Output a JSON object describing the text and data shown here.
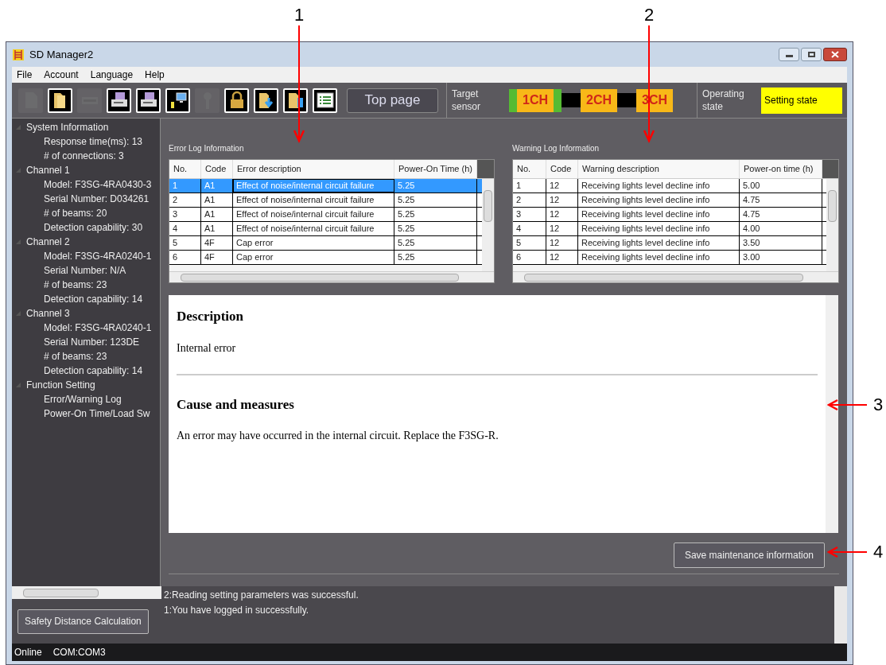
{
  "callouts": [
    {
      "label": "1",
      "kind": "down"
    },
    {
      "label": "2",
      "kind": "down"
    },
    {
      "label": "3",
      "kind": "left"
    },
    {
      "label": "4",
      "kind": "left"
    }
  ],
  "window": {
    "title": "SD Manager2"
  },
  "menu": [
    "File",
    "Account",
    "Language",
    "Help"
  ],
  "toolbar": {
    "buttons": [
      {
        "kind": "document",
        "disabled": true
      },
      {
        "kind": "folder",
        "disabled": false
      },
      {
        "kind": "device",
        "disabled": true
      },
      {
        "kind": "printer",
        "disabled": false
      },
      {
        "kind": "printer",
        "disabled": false
      },
      {
        "kind": "computer",
        "disabled": false
      },
      {
        "kind": "key",
        "disabled": true
      },
      {
        "kind": "lock",
        "disabled": false
      },
      {
        "kind": "folder-download",
        "disabled": false
      },
      {
        "kind": "folder-upload",
        "disabled": false
      },
      {
        "kind": "list",
        "disabled": false
      }
    ],
    "top_page": "Top page"
  },
  "target_sensor": {
    "label": "Target sensor",
    "channels": [
      {
        "label": "1CH",
        "selected": true
      },
      {
        "label": "2CH",
        "selected": false
      },
      {
        "label": "3CH",
        "selected": false
      }
    ]
  },
  "operating_state": {
    "label": "Operating state",
    "value": "Setting state"
  },
  "sidebar": {
    "tree": [
      {
        "label": "System Information",
        "expanded": true,
        "children": [
          {
            "label": "Response time(ms): 13"
          },
          {
            "label": "# of connections: 3"
          }
        ]
      },
      {
        "label": "Channel 1",
        "expanded": true,
        "children": [
          {
            "label": "Model: F3SG-4RA0430-3"
          },
          {
            "label": "Serial Number: D034261"
          },
          {
            "label": "# of beams: 20"
          },
          {
            "label": "Detection capability: 30"
          }
        ]
      },
      {
        "label": "Channel 2",
        "expanded": true,
        "children": [
          {
            "label": "Model: F3SG-4RA0240-1"
          },
          {
            "label": "Serial Number: N/A"
          },
          {
            "label": "# of beams: 23"
          },
          {
            "label": "Detection capability: 14"
          }
        ]
      },
      {
        "label": "Channel 3",
        "expanded": true,
        "children": [
          {
            "label": "Model: F3SG-4RA0240-1"
          },
          {
            "label": "Serial Number: 123DE"
          },
          {
            "label": "# of beams: 23"
          },
          {
            "label": "Detection capability: 14"
          }
        ]
      },
      {
        "label": "Function Setting",
        "expanded": true,
        "children": [
          {
            "label": "Error/Warning Log"
          },
          {
            "label": "Power-On Time/Load Sw"
          }
        ]
      }
    ],
    "button": "Safety Distance Calculation"
  },
  "error_log": {
    "title": "Error Log Information",
    "columns": [
      "No.",
      "Code",
      "Error description",
      "Power-On Time (h)"
    ],
    "rows": [
      {
        "cells": [
          "1",
          "A1",
          "Effect of noise/internal circuit failure",
          "5.25"
        ],
        "selected": true
      },
      {
        "cells": [
          "2",
          "A1",
          "Effect of noise/internal circuit failure",
          "5.25"
        ],
        "selected": false
      },
      {
        "cells": [
          "3",
          "A1",
          "Effect of noise/internal circuit failure",
          "5.25"
        ],
        "selected": false
      },
      {
        "cells": [
          "4",
          "A1",
          "Effect of noise/internal circuit failure",
          "5.25"
        ],
        "selected": false
      },
      {
        "cells": [
          "5",
          "4F",
          "Cap error",
          "5.25"
        ],
        "selected": false
      },
      {
        "cells": [
          "6",
          "4F",
          "Cap error",
          "5.25"
        ],
        "selected": false
      }
    ]
  },
  "warning_log": {
    "title": "Warning Log Information",
    "columns": [
      "No.",
      "Code",
      "Warning description",
      "Power-on time (h)"
    ],
    "rows": [
      {
        "cells": [
          "1",
          "12",
          "Receiving lights level decline info",
          "5.00"
        ],
        "selected": false
      },
      {
        "cells": [
          "2",
          "12",
          "Receiving lights level decline info",
          "4.75"
        ],
        "selected": false
      },
      {
        "cells": [
          "3",
          "12",
          "Receiving lights level decline info",
          "4.75"
        ],
        "selected": false
      },
      {
        "cells": [
          "4",
          "12",
          "Receiving lights level decline info",
          "4.00"
        ],
        "selected": false
      },
      {
        "cells": [
          "5",
          "12",
          "Receiving lights level decline info",
          "3.50"
        ],
        "selected": false
      },
      {
        "cells": [
          "6",
          "12",
          "Receiving lights level decline info",
          "3.00"
        ],
        "selected": false
      }
    ]
  },
  "description": {
    "heading": "Description",
    "text": "Internal error",
    "cause_heading": "Cause and measures",
    "cause_text": "An error may have occurred in the internal circuit. Replace the F3SG-R."
  },
  "save_button": "Save maintenance information",
  "messages": [
    "2:Reading setting parameters was successful.",
    "1:You have logged in successfully."
  ],
  "status_bar": {
    "state": "Online",
    "port": "COM:COM3"
  }
}
